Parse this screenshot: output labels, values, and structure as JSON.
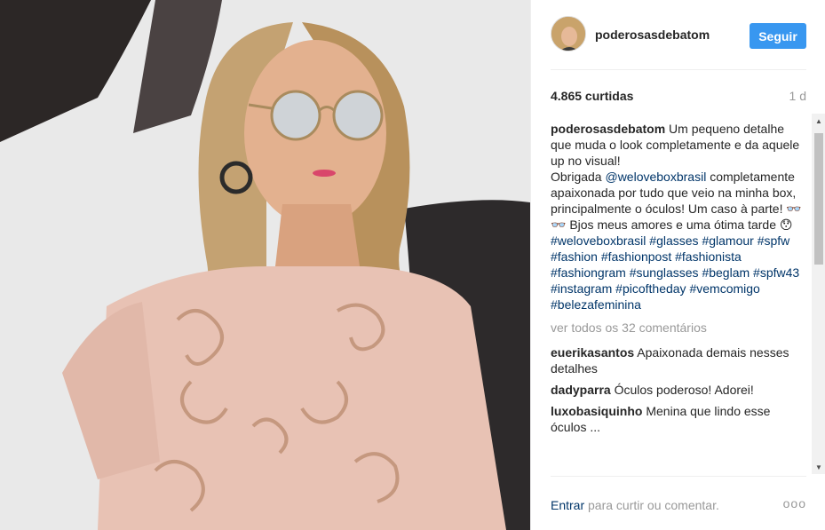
{
  "post": {
    "username": "poderosasdebatom",
    "follow_label": "Seguir",
    "likes": "4.865 curtidas",
    "time_ago": "1 d"
  },
  "caption": {
    "username": "poderosasdebatom",
    "text_1": " Um pequeno detalhe que muda o look completamente e da aquele up no visual!",
    "text_2": "Obrigada ",
    "mention": "@weloveboxbrasil",
    "text_3": " completamente apaixonada por tudo que veio na minha box, principalmente o óculos! Um caso à parte! 👓👓 Bjos meus amores e uma ótima tarde 😯",
    "hashtags": [
      "#weloveboxbrasil",
      "#glasses",
      "#glamour",
      "#spfw",
      "#fashion",
      "#fashionpost",
      "#fashionista",
      "#fashiongram",
      "#sunglasses",
      "#beglam",
      "#spfw43",
      "#instagram",
      "#picoftheday",
      "#vemcomigo",
      "#belezafeminina"
    ]
  },
  "view_all_comments": "ver todos os 32 comentários",
  "comments": [
    {
      "user": "euerikasantos",
      "text": "Apaixonada demais nesses detalhes"
    },
    {
      "user": "dadyparra",
      "text": "Óculos poderoso! Adorei!"
    },
    {
      "user": "luxobasiquinho",
      "text": "Menina que lindo esse óculos ..."
    }
  ],
  "footer": {
    "login_link": "Entrar",
    "login_rest": " para curtir ou comentar.",
    "more_label": "ooo"
  },
  "icons": {
    "scroll_up": "scroll-up-arrow-icon",
    "scroll_down": "scroll-down-arrow-icon"
  },
  "colors": {
    "follow_button": "#3897f0",
    "link": "#003569",
    "muted": "#999999"
  }
}
